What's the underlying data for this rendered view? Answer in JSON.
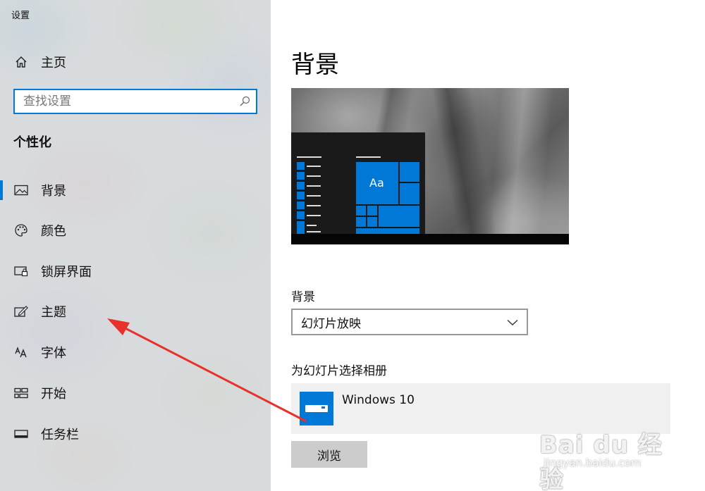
{
  "app": {
    "title": "设置"
  },
  "sidebar": {
    "home_label": "主页",
    "search_placeholder": "查找设置",
    "section_title": "个性化",
    "items": [
      {
        "label": "背景",
        "icon": "picture-icon",
        "selected": true
      },
      {
        "label": "颜色",
        "icon": "palette-icon",
        "selected": false
      },
      {
        "label": "锁屏界面",
        "icon": "lock-screen-icon",
        "selected": false
      },
      {
        "label": "主题",
        "icon": "theme-brush-icon",
        "selected": false
      },
      {
        "label": "字体",
        "icon": "font-icon",
        "selected": false
      },
      {
        "label": "开始",
        "icon": "start-tiles-icon",
        "selected": false
      },
      {
        "label": "任务栏",
        "icon": "taskbar-icon",
        "selected": false
      }
    ]
  },
  "main": {
    "page_title": "背景",
    "preview": {
      "tile_text": "Aa"
    },
    "background_label": "背景",
    "background_value": "幻灯片放映",
    "album_label": "为幻灯片选择相册",
    "album_name": "Windows 10",
    "browse_label": "浏览"
  },
  "colors": {
    "accent": "#0078d7",
    "annotation_arrow": "#e8312a"
  },
  "watermark": {
    "main": "Bai du 经验",
    "sub": "jingyan.baidu.com"
  }
}
